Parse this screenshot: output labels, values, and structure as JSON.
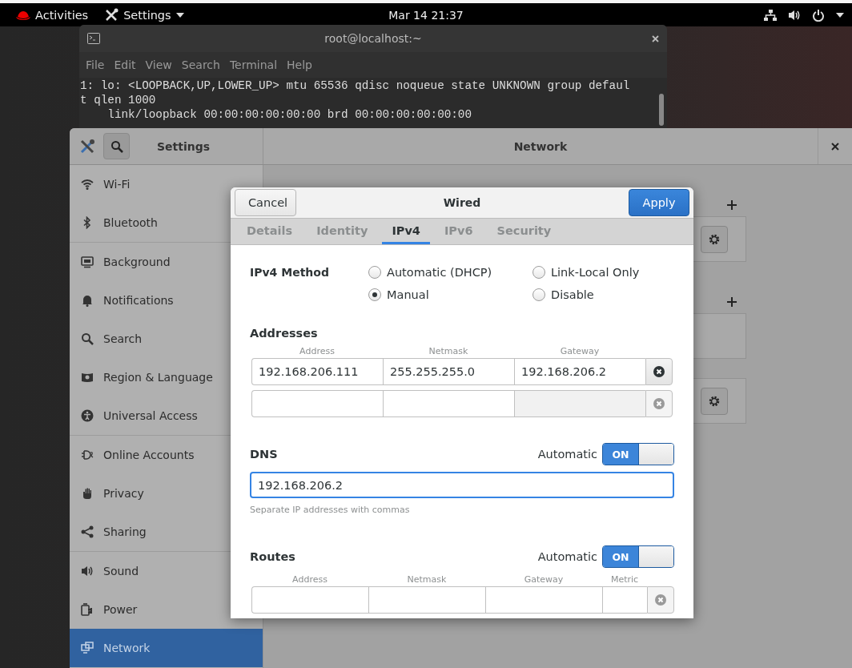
{
  "top_bar": {
    "activities": "Activities",
    "app_menu": "Settings",
    "clock": "Mar 14  21:37"
  },
  "terminal": {
    "title": "root@localhost:~",
    "menu": [
      "File",
      "Edit",
      "View",
      "Search",
      "Terminal",
      "Help"
    ],
    "lines": [
      "1: lo: <LOOPBACK,UP,LOWER_UP> mtu 65536 qdisc noqueue state UNKNOWN group defaul",
      "t qlen 1000",
      "    link/loopback 00:00:00:00:00:00 brd 00:00:00:00:00:00"
    ]
  },
  "settings": {
    "title": "Settings",
    "panel_title": "Network",
    "sidebar": [
      [
        {
          "label": "Wi-Fi",
          "selected": false
        },
        {
          "label": "Bluetooth",
          "selected": false
        }
      ],
      [
        {
          "label": "Background",
          "selected": false
        },
        {
          "label": "Notifications",
          "selected": false
        },
        {
          "label": "Search",
          "selected": false
        },
        {
          "label": "Region & Language",
          "selected": false
        },
        {
          "label": "Universal Access",
          "selected": false
        }
      ],
      [
        {
          "label": "Online Accounts",
          "selected": false
        },
        {
          "label": "Privacy",
          "selected": false
        },
        {
          "label": "Sharing",
          "selected": false
        }
      ],
      [
        {
          "label": "Sound",
          "selected": false
        },
        {
          "label": "Power",
          "selected": false
        },
        {
          "label": "Network",
          "selected": true
        }
      ]
    ]
  },
  "dialog": {
    "cancel": "Cancel",
    "title": "Wired",
    "apply": "Apply",
    "tabs": [
      {
        "label": "Details",
        "selected": false
      },
      {
        "label": "Identity",
        "selected": false
      },
      {
        "label": "IPv4",
        "selected": true
      },
      {
        "label": "IPv6",
        "selected": false
      },
      {
        "label": "Security",
        "selected": false
      }
    ],
    "method": {
      "label": "IPv4 Method",
      "options": [
        {
          "label": "Automatic (DHCP)",
          "selected": false
        },
        {
          "label": "Link-Local Only",
          "selected": false
        },
        {
          "label": "Manual",
          "selected": true
        },
        {
          "label": "Disable",
          "selected": false
        }
      ]
    },
    "addresses": {
      "heading": "Addresses",
      "columns": [
        "Address",
        "Netmask",
        "Gateway"
      ],
      "rows": [
        {
          "kind": "filled",
          "cells": [
            "192.168.206.111",
            "255.255.255.0",
            "192.168.206.2"
          ],
          "gateway_disabled": false
        },
        {
          "kind": "blank",
          "gateway_disabled": true
        }
      ]
    },
    "dns": {
      "heading": "DNS",
      "automatic_label": "Automatic",
      "toggle": {
        "on": true,
        "label": "ON"
      },
      "value": "192.168.206.2",
      "hint": "Separate IP addresses with commas"
    },
    "routes": {
      "heading": "Routes",
      "automatic_label": "Automatic",
      "toggle": {
        "on": true,
        "label": "ON"
      },
      "columns": [
        "Address",
        "Netmask",
        "Gateway",
        "Metric"
      ],
      "rows": [
        {
          "kind": "blank"
        }
      ]
    }
  }
}
